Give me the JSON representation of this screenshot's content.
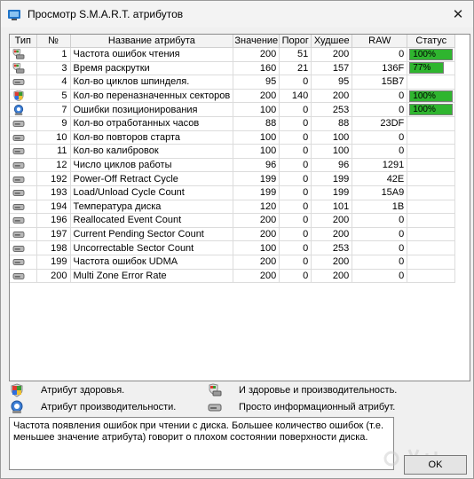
{
  "window": {
    "title": "Просмотр S.M.A.R.T. атрибутов",
    "close_label": "✕"
  },
  "table": {
    "headers": [
      "Тип",
      "№",
      "Название атрибута",
      "Значение",
      "Порог",
      "Худшее",
      "RAW",
      "Статус"
    ],
    "rows": [
      {
        "type": "both-icon",
        "id": "1",
        "name": "Частота ошибок чтения",
        "value": "200",
        "threshold": "51",
        "worst": "200",
        "raw": "0",
        "status": "100%",
        "status_fill": 1.0
      },
      {
        "type": "both-icon",
        "id": "3",
        "name": "Время раскрутки",
        "value": "160",
        "threshold": "21",
        "worst": "157",
        "raw": "136F",
        "status": "77%",
        "status_fill": 0.77
      },
      {
        "type": "info-icon",
        "id": "4",
        "name": "Кол-во циклов шпинделя.",
        "value": "95",
        "threshold": "0",
        "worst": "95",
        "raw": "15B7",
        "status": "",
        "status_fill": 0
      },
      {
        "type": "health-icon",
        "id": "5",
        "name": "Кол-во переназначенных секторов",
        "value": "200",
        "threshold": "140",
        "worst": "200",
        "raw": "0",
        "status": "100%",
        "status_fill": 1.0
      },
      {
        "type": "performance-icon",
        "id": "7",
        "name": "Ошибки позиционирования",
        "value": "100",
        "threshold": "0",
        "worst": "253",
        "raw": "0",
        "status": "100%",
        "status_fill": 1.0
      },
      {
        "type": "info-icon",
        "id": "9",
        "name": "Кол-во отработанных часов",
        "value": "88",
        "threshold": "0",
        "worst": "88",
        "raw": "23DF",
        "status": "",
        "status_fill": 0
      },
      {
        "type": "info-icon",
        "id": "10",
        "name": "Кол-во повторов старта",
        "value": "100",
        "threshold": "0",
        "worst": "100",
        "raw": "0",
        "status": "",
        "status_fill": 0
      },
      {
        "type": "info-icon",
        "id": "11",
        "name": "Кол-во калибровок",
        "value": "100",
        "threshold": "0",
        "worst": "100",
        "raw": "0",
        "status": "",
        "status_fill": 0
      },
      {
        "type": "info-icon",
        "id": "12",
        "name": "Число циклов работы",
        "value": "96",
        "threshold": "0",
        "worst": "96",
        "raw": "1291",
        "status": "",
        "status_fill": 0
      },
      {
        "type": "info-icon",
        "id": "192",
        "name": "Power-Off Retract Cycle",
        "value": "199",
        "threshold": "0",
        "worst": "199",
        "raw": "42E",
        "status": "",
        "status_fill": 0
      },
      {
        "type": "info-icon",
        "id": "193",
        "name": "Load/Unload Cycle Count",
        "value": "199",
        "threshold": "0",
        "worst": "199",
        "raw": "15A9",
        "status": "",
        "status_fill": 0
      },
      {
        "type": "info-icon",
        "id": "194",
        "name": "Температура диска",
        "value": "120",
        "threshold": "0",
        "worst": "101",
        "raw": "1B",
        "status": "",
        "status_fill": 0
      },
      {
        "type": "info-icon",
        "id": "196",
        "name": "Reallocated Event Count",
        "value": "200",
        "threshold": "0",
        "worst": "200",
        "raw": "0",
        "status": "",
        "status_fill": 0
      },
      {
        "type": "info-icon",
        "id": "197",
        "name": "Current Pending Sector Count",
        "value": "200",
        "threshold": "0",
        "worst": "200",
        "raw": "0",
        "status": "",
        "status_fill": 0
      },
      {
        "type": "info-icon",
        "id": "198",
        "name": "Uncorrectable Sector Count",
        "value": "100",
        "threshold": "0",
        "worst": "253",
        "raw": "0",
        "status": "",
        "status_fill": 0
      },
      {
        "type": "info-icon",
        "id": "199",
        "name": "Частота ошибок UDMA",
        "value": "200",
        "threshold": "0",
        "worst": "200",
        "raw": "0",
        "status": "",
        "status_fill": 0
      },
      {
        "type": "info-icon",
        "id": "200",
        "name": "Multi Zone Error Rate",
        "value": "200",
        "threshold": "0",
        "worst": "200",
        "raw": "0",
        "status": "",
        "status_fill": 0
      }
    ]
  },
  "legend": {
    "health": "Атрибут здоровья.",
    "both": "И здоровье и производительность.",
    "performance": "Атрибут производительности.",
    "info": "Просто информационный атрибут."
  },
  "description": "Частота появления ошибок при чтении с диска. Большее количество ошибок (т.е. меньшее значение атрибута) говорит о плохом состоянии поверхности диска.",
  "buttons": {
    "ok": "OK"
  },
  "colors": {
    "status_green": "#2fb52f",
    "selection": "#0078d7"
  }
}
